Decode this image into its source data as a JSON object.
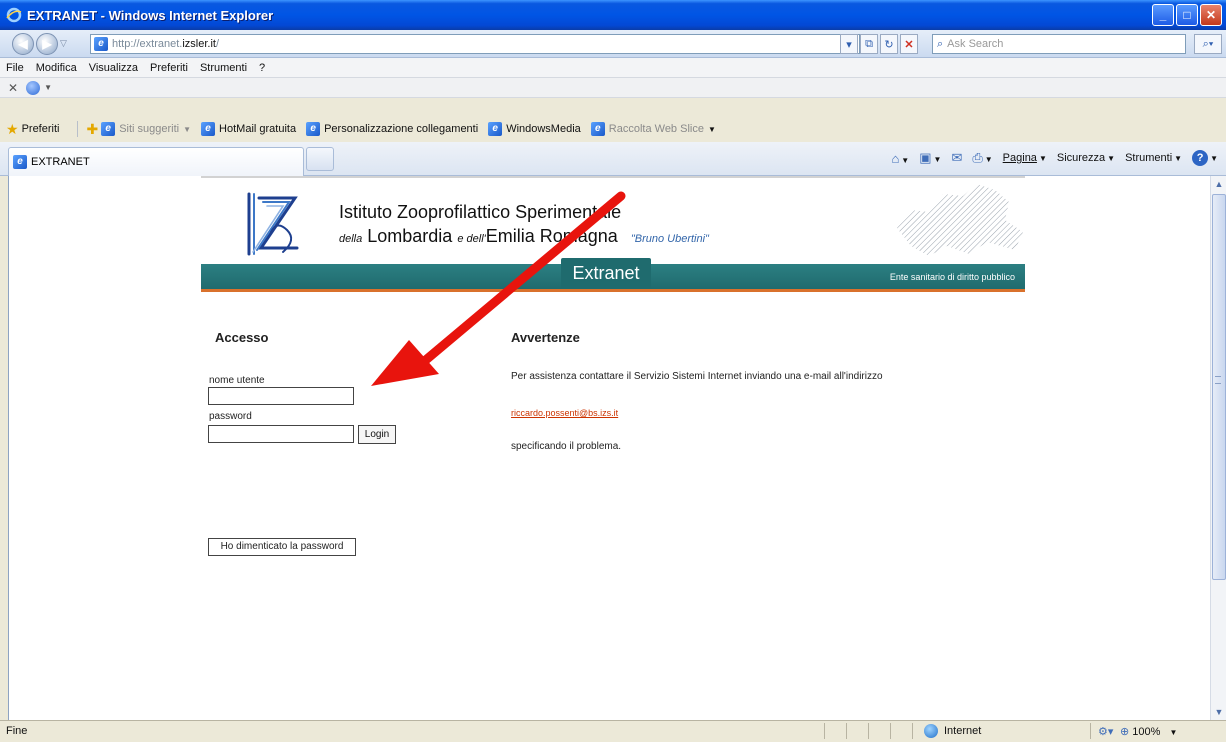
{
  "window": {
    "title": "EXTRANET - Windows Internet Explorer"
  },
  "address": {
    "url_prefix": "http://extranet.",
    "url_host": "izsler.it",
    "url_suffix": "/",
    "search_placeholder": "Ask Search"
  },
  "menu": [
    "File",
    "Modifica",
    "Visualizza",
    "Preferiti",
    "Strumenti",
    "?"
  ],
  "favorites": {
    "label": "Preferiti",
    "items": [
      {
        "label": "Siti suggeriti",
        "dim": true,
        "dropdown": true
      },
      {
        "label": "HotMail gratuita",
        "dim": false,
        "dropdown": false
      },
      {
        "label": "Personalizzazione collegamenti",
        "dim": false,
        "dropdown": false
      },
      {
        "label": "WindowsMedia",
        "dim": false,
        "dropdown": false
      },
      {
        "label": "Raccolta Web Slice",
        "dim": true,
        "dropdown": true
      }
    ]
  },
  "tabs": [
    {
      "label": "EXTRANET",
      "active": true
    }
  ],
  "command_bar": {
    "page": "Pagina",
    "security": "Sicurezza",
    "tools": "Strumenti"
  },
  "site": {
    "inst_line1": "Istituto Zooprofilattico Sperimentale",
    "inst_della": "della",
    "inst_lombardia": "Lombardia",
    "inst_edell": "e dell'",
    "inst_emilia": "Emilia Romagna",
    "inst_name": "\"Bruno Ubertini\"",
    "band_title": "Extranet",
    "band_note": "Ente sanitario di diritto pubblico"
  },
  "login": {
    "heading": "Accesso",
    "username_label": "nome utente",
    "username_value": "",
    "password_label": "password",
    "password_value": "",
    "login_button": "Login",
    "forgot_button": "Ho dimenticato la password"
  },
  "notice": {
    "heading": "Avvertenze",
    "text1": "Per assistenza contattare il Servizio Sistemi Internet inviando una e-mail all'indirizzo",
    "email": "riccardo.possenti@bs.izs.it",
    "text2": "specificando il problema."
  },
  "status": {
    "text": "Fine",
    "zone": "Internet",
    "zoom": "100%"
  },
  "colors": {
    "teal": "#1f6b6e",
    "orange_rule": "#d9712c",
    "annotation_arrow": "#e8140d",
    "link": "#cc3300"
  }
}
